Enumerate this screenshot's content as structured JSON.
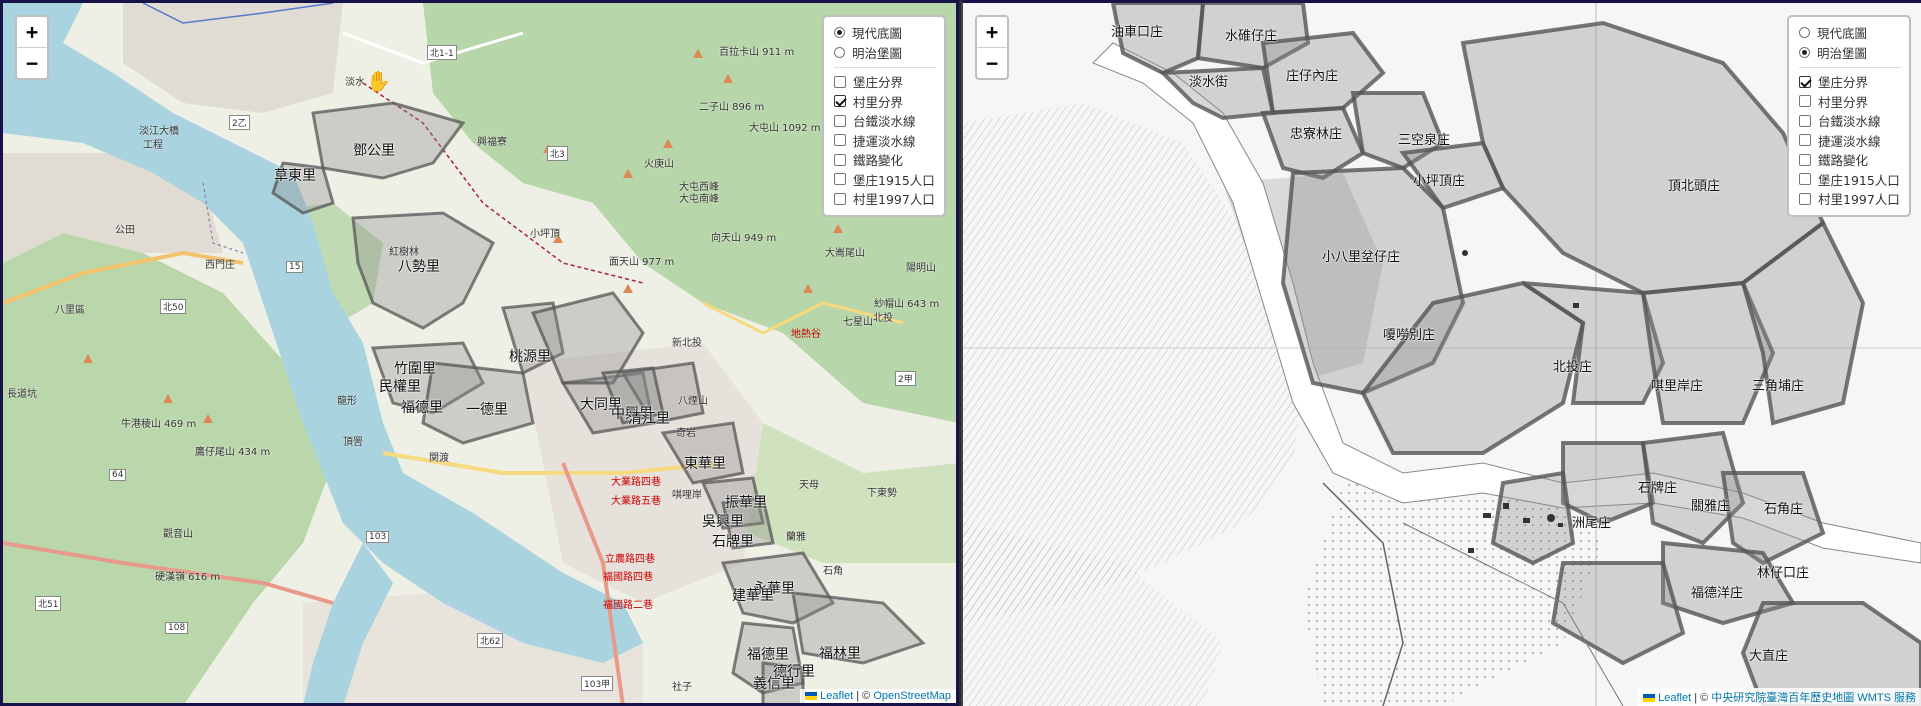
{
  "left_map": {
    "zoom_in": "+",
    "zoom_out": "−",
    "layers": {
      "base": [
        {
          "label": "現代底圖",
          "selected": true
        },
        {
          "label": "明治堡圖",
          "selected": false
        }
      ],
      "overlays": [
        {
          "label": "堡庄分界",
          "checked": false
        },
        {
          "label": "村里分界",
          "checked": true
        },
        {
          "label": "台鐵淡水線",
          "checked": false
        },
        {
          "label": "捷運淡水線",
          "checked": false
        },
        {
          "label": "鐵路變化",
          "checked": false
        },
        {
          "label": "堡庄1915人口",
          "checked": false
        },
        {
          "label": "村里1997人口",
          "checked": false
        }
      ]
    },
    "attribution": {
      "leaflet": "Leaflet",
      "sep": " | © ",
      "source": "OpenStreetMap"
    },
    "village_labels": [
      "鄧公里",
      "草東里",
      "八勢里",
      "竹圍里",
      "民權里",
      "福德里",
      "一德里",
      "桃源里",
      "大同里",
      "中興里",
      "清江里",
      "東華里",
      "振華里",
      "吳興里",
      "石牌里",
      "永華里",
      "福林里",
      "福德里",
      "義信里",
      "德行里",
      "建華里"
    ],
    "place_labels": [
      "淡水",
      "紅樹林",
      "八里區",
      "公田",
      "西門庄",
      "龍形",
      "頂罟",
      "関渡",
      "奇岩",
      "唭哩岸",
      "天母",
      "蘭雅",
      "石角",
      "下東勢",
      "社子",
      "陽明山",
      "北投",
      "新北投",
      "小坪頂",
      "長道坑",
      "八煙山",
      "興福寮",
      "工程",
      "淡江大橋"
    ],
    "mountain_labels": [
      "百拉卡山 911 m",
      "二子山 896 m",
      "大屯山 1092 m",
      "大屯西峰",
      "大屯南峰",
      "面天山 977 m",
      "向天山 949 m",
      "火庚山",
      "紗帽山 643 m",
      "大崙尾山",
      "七星山",
      "觀音山",
      "牛港稜山 469 m",
      "鷹仔尾山 434 m",
      "硬漢嶺 616 m"
    ],
    "red_labels": [
      "地熱谷",
      "大業路四巷",
      "大業路五巷",
      "立農路四巷",
      "福國路四巷",
      "福國路二巷"
    ],
    "road_shields": [
      "北1-1",
      "2乙",
      "北3",
      "15",
      "北50",
      "64",
      "103",
      "北51",
      "108",
      "北62",
      "103甲",
      "2甲",
      "北投"
    ]
  },
  "right_map": {
    "zoom_in": "+",
    "zoom_out": "−",
    "layers": {
      "base": [
        {
          "label": "現代底圖",
          "selected": false
        },
        {
          "label": "明治堡圖",
          "selected": true
        }
      ],
      "overlays": [
        {
          "label": "堡庄分界",
          "checked": true
        },
        {
          "label": "村里分界",
          "checked": false
        },
        {
          "label": "台鐵淡水線",
          "checked": false
        },
        {
          "label": "捷運淡水線",
          "checked": false
        },
        {
          "label": "鐵路變化",
          "checked": false
        },
        {
          "label": "堡庄1915人口",
          "checked": false
        },
        {
          "label": "村里1997人口",
          "checked": false
        }
      ]
    },
    "attribution": {
      "leaflet": "Leaflet",
      "sep": " | © ",
      "source": "中央研究院臺灣百年歷史地圖 WMTS 服務"
    },
    "hist_labels": [
      "油車口庄",
      "水碓仔庄",
      "淡水街",
      "庄仔內庄",
      "忠寮林庄",
      "三空泉庄",
      "小坪頂庄",
      "頂北頭庄",
      "小八里坌仔庄",
      "嗄嘮別庄",
      "北投庄",
      "唭里岸庄",
      "三角埔庄",
      "石牌庄",
      "洲尾庄",
      "關雅庄",
      "石角庄",
      "林仔口庄",
      "福德洋庄",
      "大直庄"
    ]
  },
  "colors": {
    "pane_border": "#17124a",
    "river": "#a9d3df",
    "forest": "#add19e",
    "village_fill": "#8c8c8c",
    "village_stroke": "#555555"
  }
}
